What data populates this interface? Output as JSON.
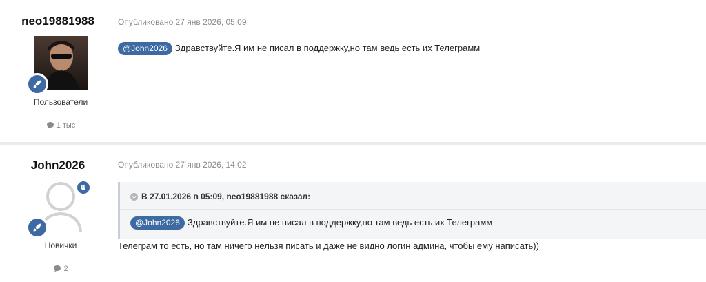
{
  "posts": [
    {
      "author": "neo19881988",
      "group": "Пользователи",
      "post_count": "1 тыс",
      "published": "Опубликовано 27 янв 2026, 05:09",
      "mention": "@John2026",
      "text": "Здравствуйте.Я им не писал в поддержку,но там ведь есть их Телеграмм",
      "icons": {
        "badge": "rocket-icon",
        "count": "comment-icon"
      }
    },
    {
      "author": "John2026",
      "group": "Новички",
      "post_count": "2",
      "published": "Опубликовано 27 янв 2026, 14:02",
      "quote": {
        "header": "В 27.01.2026 в 05:09, neo19881988 сказал:",
        "mention": "@John2026",
        "text": "Здравствуйте.Я им не писал в поддержку,но там ведь есть их Телеграмм"
      },
      "text": "Телеграм то есть, но там ничего нельзя писать и даже не видно логин админа, чтобы ему написать))",
      "icons": {
        "badge": "rocket-icon",
        "status": "hand-icon",
        "count": "comment-icon",
        "avatar": "default-avatar-icon"
      }
    }
  ],
  "colors": {
    "accent": "#3d6aa3",
    "muted": "#8a8a8a",
    "quote_bg": "#f4f5f7"
  }
}
